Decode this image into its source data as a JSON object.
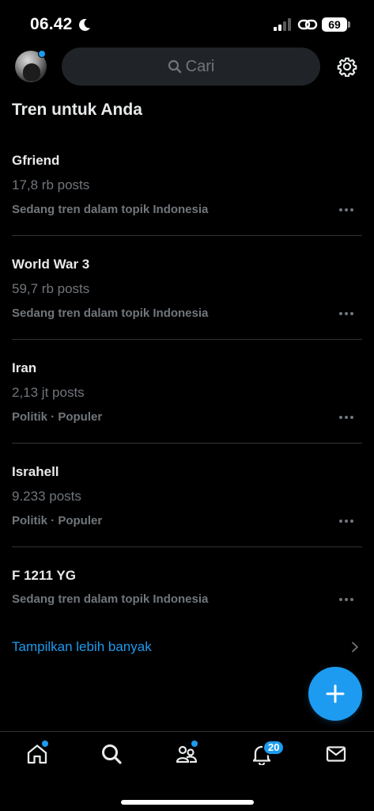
{
  "status_bar": {
    "time": "06.42",
    "battery": "69"
  },
  "header": {
    "search_placeholder": "Cari"
  },
  "section": {
    "title": "Tren untuk Anda"
  },
  "trends": [
    {
      "name": "Gfriend",
      "posts": "17,8 rb posts",
      "context": "Sedang tren dalam topik Indonesia"
    },
    {
      "name": "World War 3",
      "posts": "59,7 rb posts",
      "context": "Sedang tren dalam topik Indonesia"
    },
    {
      "name": "Iran",
      "posts": "2,13 jt posts",
      "context": "Politik · Populer"
    },
    {
      "name": "Israhell",
      "posts": "9.233 posts",
      "context": "Politik · Populer"
    },
    {
      "name": "F 1211 YG",
      "posts": "",
      "context": "Sedang tren dalam topik Indonesia"
    }
  ],
  "show_more": "Tampilkan lebih banyak",
  "bottom_nav": {
    "notifications_badge": "20",
    "items": [
      "home-icon",
      "search-icon",
      "communities-icon",
      "bell-icon",
      "mail-icon"
    ]
  },
  "colors": {
    "background": "#000000",
    "accent": "#1d9bf0",
    "text_primary": "#e7e9ea",
    "text_secondary": "#71767b",
    "divider": "#2f3336",
    "search_bg": "#202327"
  }
}
